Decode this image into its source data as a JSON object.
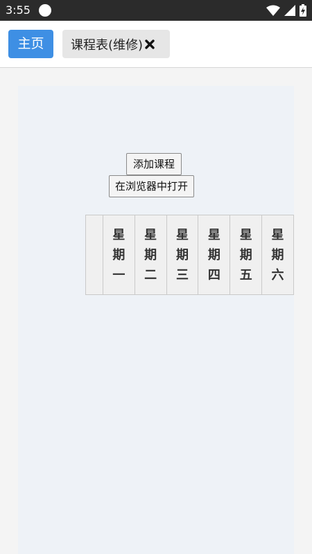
{
  "status_bar": {
    "time": "3:55",
    "icons": [
      "notification-dot-icon",
      "wifi-icon",
      "signal-icon",
      "battery-charging-icon"
    ]
  },
  "topbar": {
    "home_label": "主页",
    "tab_label": "课程表(维修)",
    "tab_close_icon": "close-icon"
  },
  "content": {
    "add_course_label": "添加课程",
    "open_in_browser_label": "在浏览器中打开",
    "schedule": {
      "days": [
        "星期一",
        "星期二",
        "星期三",
        "星期四",
        "星期五",
        "星期六"
      ]
    }
  },
  "colors": {
    "status_bar": "#2b2b2b",
    "home_button": "#3e8fe4",
    "tab_background": "#e6e6e6",
    "content_background": "#eef2f7"
  }
}
